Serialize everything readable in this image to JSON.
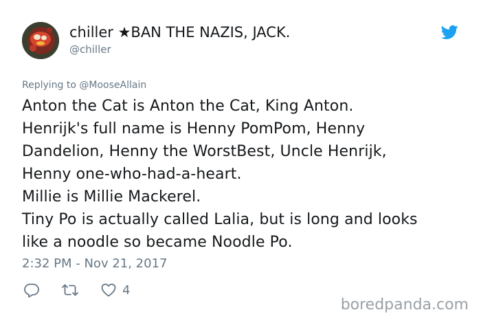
{
  "author": {
    "display_name": "chiller ★BAN THE NAZIS, JACK.",
    "handle": "@chiller"
  },
  "replying": {
    "prefix": "Replying to ",
    "mention": "@MooseAllain"
  },
  "tweet": {
    "lines": [
      "Anton the Cat is Anton the Cat, King Anton.",
      "Henrijk's full name is Henny PomPom, Henny",
      "Dandelion, Henny the WorstBest, Uncle Henrijk,",
      "Henny one-who-had-a-heart.",
      "Millie is Millie Mackerel.",
      "Tiny Po is actually called Lalia, but is long and looks",
      "like a noodle so became Noodle Po."
    ],
    "timestamp": "2:32 PM - Nov 21, 2017"
  },
  "actions": {
    "like_count": "4"
  },
  "watermark": "boredpanda.com",
  "colors": {
    "twitter_blue": "#1da1f2",
    "secondary_text": "#657786"
  },
  "icons": [
    "avatar-image",
    "twitter-bird-icon",
    "reply-icon",
    "retweet-icon",
    "like-heart-icon"
  ]
}
